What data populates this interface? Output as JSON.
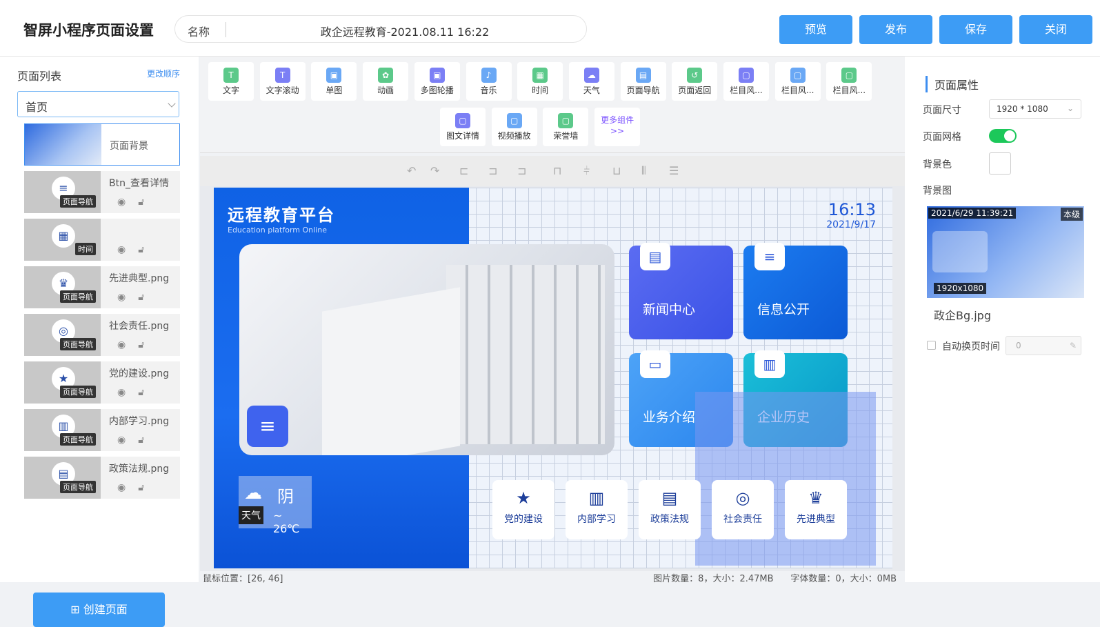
{
  "header": {
    "title": "智屏小程序页面设置",
    "name_label": "名称",
    "name_value": "政企远程教育-2021.08.11 16:22",
    "buttons": {
      "preview": "预览",
      "publish": "发布",
      "save": "保存",
      "close": "关闭"
    }
  },
  "sidebar": {
    "title": "页面列表",
    "reorder": "更改顺序",
    "page_select": "首页",
    "layers": [
      {
        "name": "页面背景",
        "tag": "",
        "icon": ""
      },
      {
        "name": "Btn_查看详情",
        "tag": "页面导航",
        "icon": "≡"
      },
      {
        "name": "",
        "tag": "时间",
        "icon": "▦"
      },
      {
        "name": "先进典型.png",
        "tag": "页面导航",
        "icon": "♛"
      },
      {
        "name": "社会责任.png",
        "tag": "页面导航",
        "icon": "◎"
      },
      {
        "name": "党的建设.png",
        "tag": "页面导航",
        "icon": "★"
      },
      {
        "name": "内部学习.png",
        "tag": "页面导航",
        "icon": "▥"
      },
      {
        "name": "政策法规.png",
        "tag": "页面导航",
        "icon": "▤"
      }
    ],
    "create_button": "创建页面"
  },
  "components": [
    {
      "label": "文字",
      "icon": "T",
      "color": "#5cc98a"
    },
    {
      "label": "文字滚动",
      "icon": "T",
      "color": "#7b7ff5"
    },
    {
      "label": "单图",
      "icon": "▣",
      "color": "#6aa8f5"
    },
    {
      "label": "动画",
      "icon": "✿",
      "color": "#5cc98a"
    },
    {
      "label": "多图轮播",
      "icon": "▣",
      "color": "#7b7ff5"
    },
    {
      "label": "音乐",
      "icon": "♪",
      "color": "#6aa8f5"
    },
    {
      "label": "时间",
      "icon": "▦",
      "color": "#5cc98a"
    },
    {
      "label": "天气",
      "icon": "☁",
      "color": "#7b7ff5"
    },
    {
      "label": "页面导航",
      "icon": "▤",
      "color": "#6aa8f5"
    },
    {
      "label": "页面返回",
      "icon": "↺",
      "color": "#5cc98a"
    },
    {
      "label": "栏目风...",
      "icon": "▢",
      "color": "#7b7ff5"
    },
    {
      "label": "栏目风...",
      "icon": "▢",
      "color": "#6aa8f5"
    },
    {
      "label": "栏目风...",
      "icon": "▢",
      "color": "#5cc98a"
    },
    {
      "label": "图文详情",
      "icon": "▢",
      "color": "#7b7ff5"
    },
    {
      "label": "视频播放",
      "icon": "▢",
      "color": "#6aa8f5"
    },
    {
      "label": "荣誉墙",
      "icon": "▢",
      "color": "#5cc98a"
    },
    {
      "label": "更多组件>>",
      "icon": "",
      "color": ""
    }
  ],
  "canvas": {
    "logo_cn": "远程教育平台",
    "logo_en": "Education platform Online",
    "time": "16:13",
    "date": "2021/9/17",
    "tiles": [
      "新闻中心",
      "信息公开",
      "业务介绍",
      "企业历史"
    ],
    "bottom_nav": [
      "党的建设",
      "内部学习",
      "政策法规",
      "社会责任",
      "先进典型"
    ],
    "weather": "阴",
    "temp": "~ 26℃",
    "weather_tag": "天气"
  },
  "status": {
    "mouse": "鼠标位置：[26, 46]",
    "stats": "图片数量：8，大小：2.47MB      字体数量：0，大小：0MB"
  },
  "props": {
    "title": "页面属性",
    "size_label": "页面尺寸",
    "size_value": "1920 * 1080",
    "grid_label": "页面网格",
    "grid_on": true,
    "bgcolor_label": "背景色",
    "bgimage_label": "背景图",
    "bg_timestamp": "2021/6/29 11:39:21",
    "bg_badge": "本级",
    "bg_dims": "1920x1080",
    "bg_name": "政企Bg.jpg",
    "auto_label": "自动换页时间",
    "auto_value": "0"
  }
}
